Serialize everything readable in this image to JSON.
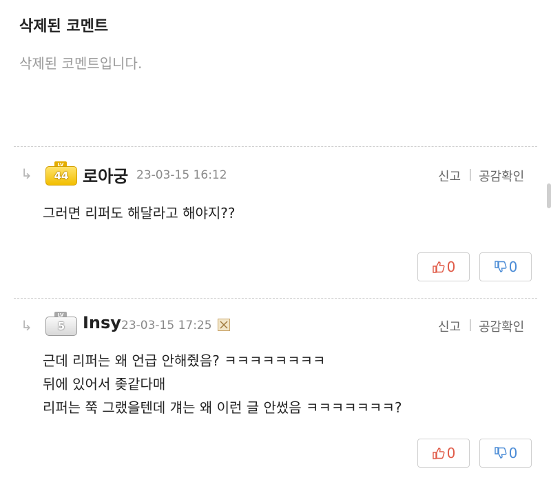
{
  "deleted_comment": {
    "title": "삭제된 코멘트",
    "body": "삭제된 코멘트입니다."
  },
  "comments": [
    {
      "level": "44",
      "level_tag": "LV",
      "author": "로아궁",
      "date": "23-03-15 16:12",
      "report_label": "신고",
      "separator": "|",
      "like_check_label": "공감확인",
      "lines": [
        "그러면 리퍼도 해달라고 해야지??"
      ],
      "upvotes": "0",
      "downvotes": "0"
    },
    {
      "level": "5",
      "level_tag": "LV",
      "author": "Insy",
      "date": "23-03-15 17:25",
      "report_label": "신고",
      "separator": "|",
      "like_check_label": "공감확인",
      "lines": [
        "근데 리퍼는 왜 언급 안해줬음? ㅋㅋㅋㅋㅋㅋㅋㅋ",
        "뒤에 있어서 좆같다매",
        "리퍼는 쭉 그랬을텐데 걔는 왜 이런 글 안썼음 ㅋㅋㅋㅋㅋㅋㅋ?"
      ],
      "upvotes": "0",
      "downvotes": "0"
    }
  ],
  "colors": {
    "upvote": "#e05a47",
    "downvote": "#4a8bd6",
    "badge_gold": "#f2be00",
    "badge_silver": "#d8d8d8"
  }
}
